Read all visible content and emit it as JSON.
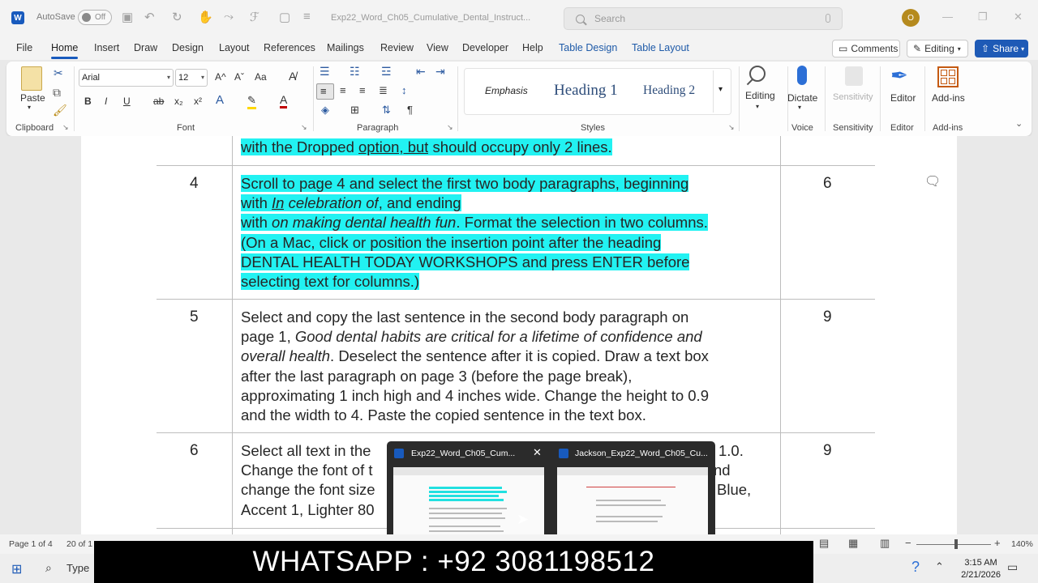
{
  "titlebar": {
    "logo": "W",
    "autosave_label": "AutoSave",
    "toggle_label": "Off",
    "doc_title": "Exp22_Word_Ch05_Cumulative_Dental_Instruct...",
    "search_placeholder": "Search",
    "avatar_initial": "O"
  },
  "menu": {
    "tabs": [
      "File",
      "Home",
      "Insert",
      "Draw",
      "Design",
      "Layout",
      "References",
      "Mailings",
      "Review",
      "View",
      "Developer",
      "Help"
    ],
    "context_tabs": [
      "Table Design",
      "Table Layout"
    ],
    "comments": "Comments",
    "editing": "Editing",
    "share": "Share"
  },
  "ribbon": {
    "clipboard": {
      "paste": "Paste",
      "label": "Clipboard"
    },
    "font": {
      "name": "Arial",
      "size": "12",
      "label": "Font",
      "bold": "B",
      "italic": "I",
      "underline": "U",
      "strike": "ab",
      "sub": "x₂",
      "sup": "x²",
      "grow": "A^",
      "shrink": "Aˇ",
      "case": "Aa"
    },
    "paragraph": {
      "label": "Paragraph"
    },
    "styles": {
      "label": "Styles",
      "emphasis": "Emphasis",
      "heading1": "Heading 1",
      "heading2": "Heading 2"
    },
    "editing": {
      "label": "Editing"
    },
    "voice": {
      "dictate": "Dictate",
      "label": "Voice"
    },
    "sensitivity": {
      "button": "Sensitivity",
      "label": "Sensitivity"
    },
    "editor": {
      "button": "Editor",
      "label": "Editor"
    },
    "addins": {
      "button": "Add-ins",
      "label": "Add-ins"
    }
  },
  "document": {
    "row3_tail_before": "with the Dropped ",
    "row3_tail_link": "option, but",
    "row3_tail_after": " should occupy only 2 lines.",
    "row4": {
      "num": "4",
      "points": "6",
      "l1": "Scroll to page 4 and select the first two body paragraphs, beginning",
      "l2a": "with ",
      "l2b": "In",
      "l2c": " celebration of",
      "l2d": ", and ending",
      "l3a": "with ",
      "l3b": "on making dental health fun",
      "l3c": ". Format the selection in two columns.",
      "l4": "(On a Mac, click or position the insertion point after the heading",
      "l5": "DENTAL HEALTH TODAY WORKSHOPS and press ENTER before",
      "l6": "selecting text for columns.)"
    },
    "row5": {
      "num": "5",
      "points": "9",
      "l1": "Select and copy the last sentence in the second body paragraph on",
      "l2a": "page 1, ",
      "l2b": "Good dental habits are critical for a lifetime of confidence and",
      "l3a": "overall health",
      "l3b": ". Deselect the sentence after it is copied. Draw a text box",
      "l4": "after the last paragraph on page 3 (before the page break),",
      "l5": "approximating 1 inch high and 4 inches wide. Change the height to 0.9",
      "l6": "and the width to 4. Paste the copied sentence in the text box."
    },
    "row6": {
      "num": "6",
      "points": "9",
      "l1": "Select all text in the",
      "l1_end": "1.0.",
      "l2": "Change the font of t",
      "l2_end": "nd",
      "l3": "change the font size",
      "l3_end": "Blue,",
      "l4": "Accent 1, Lighter 80"
    }
  },
  "previews": {
    "left_title": "Exp22_Word_Ch05_Cum...",
    "right_title": "Jackson_Exp22_Word_Ch05_Cu..."
  },
  "status": {
    "page": "Page 1 of 4",
    "words": "20 of 1",
    "zoom": "140%"
  },
  "taskbar": {
    "search": "Type",
    "banner": "WHATSAPP :  +92 3081198512",
    "time": "3:15 AM",
    "date": "2/21/2026"
  }
}
